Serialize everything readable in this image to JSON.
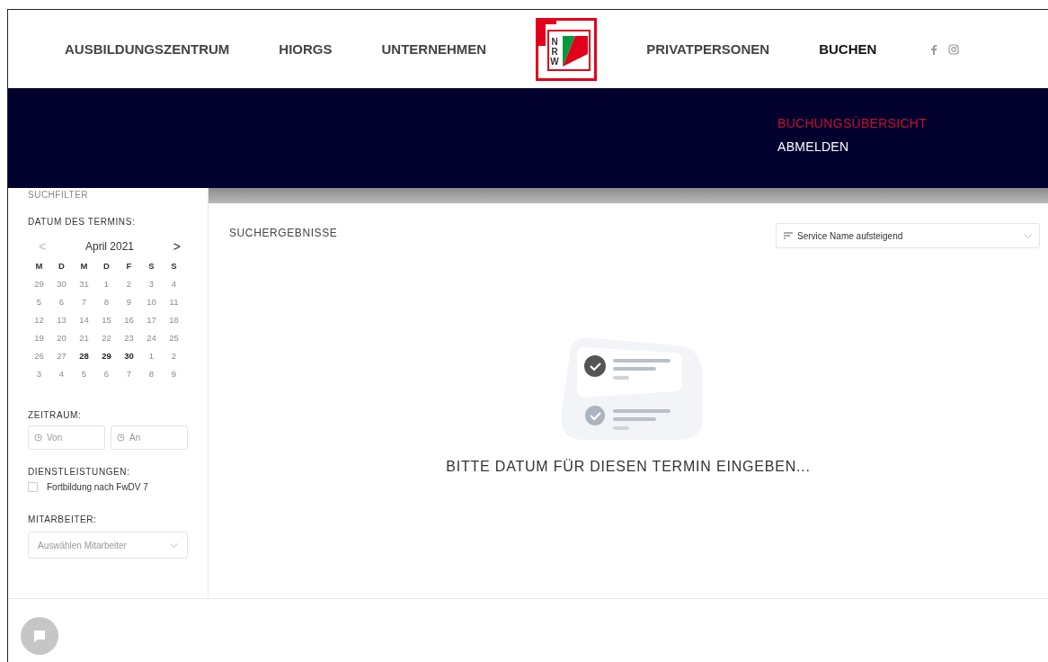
{
  "header": {
    "nav_left": [
      {
        "label": "AUSBILDUNGSZENTRUM",
        "selected": false
      },
      {
        "label": "HIORGS",
        "selected": false
      },
      {
        "label": "UNTERNEHMEN",
        "selected": false
      }
    ],
    "logo": {
      "letters": [
        "N",
        "R",
        "W"
      ]
    },
    "nav_right": [
      {
        "label": "PRIVATPERSONEN",
        "selected": false
      },
      {
        "label": "BUCHEN",
        "selected": true
      }
    ]
  },
  "submenu": [
    {
      "label": "BUCHUNGSÜBERSICHT",
      "selected": true
    },
    {
      "label": "ABMELDEN",
      "selected": false
    }
  ],
  "sidebar": {
    "title": "SUCHFILTER",
    "date_label": "DATUM DES TERMINS:",
    "calendar": {
      "month": "April 2021",
      "prev": "<",
      "next": ">",
      "weekdays": [
        "M",
        "D",
        "M",
        "D",
        "F",
        "S",
        "S"
      ],
      "weeks": [
        [
          {
            "day": "29",
            "available": false
          },
          {
            "day": "30",
            "available": false
          },
          {
            "day": "31",
            "available": false
          },
          {
            "day": "1",
            "available": false
          },
          {
            "day": "2",
            "available": false
          },
          {
            "day": "3",
            "available": false
          },
          {
            "day": "4",
            "available": false
          }
        ],
        [
          {
            "day": "5",
            "available": false
          },
          {
            "day": "6",
            "available": false
          },
          {
            "day": "7",
            "available": false
          },
          {
            "day": "8",
            "available": false
          },
          {
            "day": "9",
            "available": false
          },
          {
            "day": "10",
            "available": false
          },
          {
            "day": "11",
            "available": false
          }
        ],
        [
          {
            "day": "12",
            "available": false
          },
          {
            "day": "13",
            "available": false
          },
          {
            "day": "14",
            "available": false
          },
          {
            "day": "15",
            "available": false
          },
          {
            "day": "16",
            "available": false
          },
          {
            "day": "17",
            "available": false
          },
          {
            "day": "18",
            "available": false
          }
        ],
        [
          {
            "day": "19",
            "available": false
          },
          {
            "day": "20",
            "available": false
          },
          {
            "day": "21",
            "available": false
          },
          {
            "day": "22",
            "available": false
          },
          {
            "day": "23",
            "available": false
          },
          {
            "day": "24",
            "available": false
          },
          {
            "day": "25",
            "available": false
          }
        ],
        [
          {
            "day": "26",
            "available": false
          },
          {
            "day": "27",
            "available": false
          },
          {
            "day": "28",
            "available": true
          },
          {
            "day": "29",
            "available": true
          },
          {
            "day": "30",
            "available": true
          },
          {
            "day": "1",
            "available": false
          },
          {
            "day": "2",
            "available": false
          }
        ],
        [
          {
            "day": "3",
            "available": false
          },
          {
            "day": "4",
            "available": false
          },
          {
            "day": "5",
            "available": false
          },
          {
            "day": "6",
            "available": false
          },
          {
            "day": "7",
            "available": false
          },
          {
            "day": "8",
            "available": false
          },
          {
            "day": "9",
            "available": false
          }
        ]
      ]
    },
    "period_label": "ZEITRAUM:",
    "period_fields": [
      {
        "placeholder": "Von"
      },
      {
        "placeholder": "An"
      }
    ],
    "services_label": "DIENSTLEISTUNGEN:",
    "services": [
      {
        "label": "Fortbildung nach FwDV 7",
        "checked": false
      }
    ],
    "staff_label": "MITARBEITER:",
    "staff_select": {
      "placeholder": "Auswählen Mitarbeiter"
    }
  },
  "results": {
    "title": "SUCHERGEBNISSE",
    "sort": {
      "value": "Service Name aufsteigend"
    },
    "empty_message": "BITTE DATUM FÜR DIESEN TERMIN EINGEBEN..."
  }
}
